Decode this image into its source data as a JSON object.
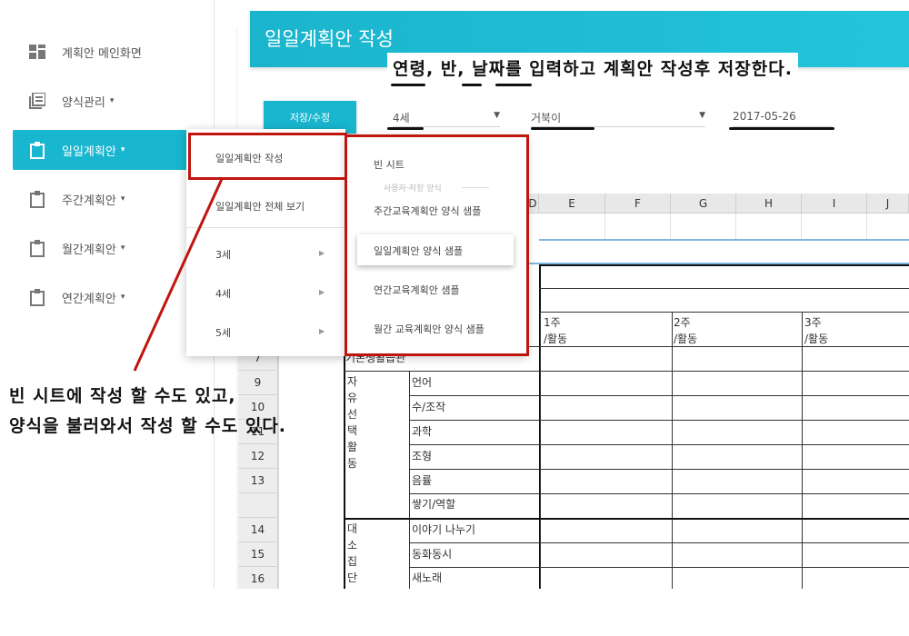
{
  "sidebar": {
    "items": [
      {
        "label": "계획안 메인화면",
        "icon": "dashboard-icon",
        "caret": ""
      },
      {
        "label": "양식관리",
        "icon": "forms-icon",
        "caret": "▾"
      },
      {
        "label": "일일계획안",
        "icon": "clipboard-icon",
        "caret": "▾"
      },
      {
        "label": "주간계획안",
        "icon": "clipboard-icon",
        "caret": "▾"
      },
      {
        "label": "월간계획안",
        "icon": "clipboard-icon",
        "caret": "▾"
      },
      {
        "label": "연간계획안",
        "icon": "clipboard-icon",
        "caret": "▾"
      }
    ]
  },
  "header": {
    "title": "일일계획안 작성"
  },
  "annotation_top": "연령, 반, 날짜를 입력하고 계획안 작성후 저장한다.",
  "toolbar": {
    "save_label": "저장/수정",
    "age_select": "4세",
    "class_select": "거북이",
    "date_value": "2017-05-26",
    "dropdown_arrow": "▼"
  },
  "sheet": {
    "columns": [
      "E",
      "F",
      "G",
      "H",
      "I",
      "J"
    ],
    "row_numbers": [
      "9",
      "10",
      "11",
      "12",
      "13",
      "14",
      "15",
      "16"
    ],
    "partial_column": "D",
    "partial_row": "7",
    "week_headers": [
      {
        "week": "1주",
        "sub": "/활동"
      },
      {
        "week": "2주",
        "sub": "/활동"
      },
      {
        "week": "3주",
        "sub": "/활동"
      }
    ],
    "basic_life_label": "기본생활습관",
    "free_choice_label": "자유선택활동",
    "free_choice_items": [
      "언어",
      "수/조작",
      "과학",
      "조형",
      "음률",
      "쌓기/역할"
    ],
    "group_label": "대소집단",
    "group_items": [
      "이야기 나누기",
      "동화동시",
      "새노래"
    ]
  },
  "menu_level1": {
    "items": [
      "일일계획안 작성",
      "일일계획안 전체 보기"
    ],
    "ages": [
      "3세",
      "4세",
      "5세"
    ],
    "arrow": "▶"
  },
  "menu_level2": {
    "blank": "빈 시트",
    "section_label": "사용자 저장 양식",
    "items": [
      "주간교육계획안 양식 샘플",
      "일일계획안 양식 샘플",
      "연간교육계획안 샘플",
      "월간 교육계획안 양식 샘플"
    ]
  },
  "annotation_bottom": [
    "빈 시트에 작성 할 수도 있고,",
    "양식을 불러와서 작성 할 수도 있다."
  ],
  "colors": {
    "accent": "#18b6cf",
    "annotation_red": "#c0150e"
  }
}
